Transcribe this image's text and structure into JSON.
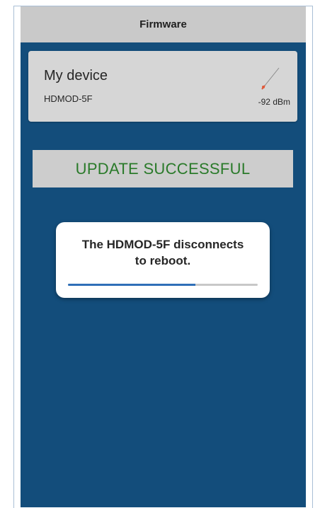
{
  "header": {
    "title": "Firmware"
  },
  "device": {
    "name": "My device",
    "model": "HDMOD-5F",
    "signal": "-92 dBm",
    "signal_icon": "signal-strength-icon"
  },
  "status": {
    "banner": "UPDATE SUCCESSFUL",
    "banner_color": "#2a7a2a"
  },
  "dialog": {
    "message_line1": "The HDMOD-5F disconnects",
    "message_line2": "to reboot.",
    "progress": 0.67
  },
  "colors": {
    "background": "#134d7b",
    "header": "#c9c9c9",
    "card": "#d6d6d6",
    "progress": "#2f6fb8"
  }
}
